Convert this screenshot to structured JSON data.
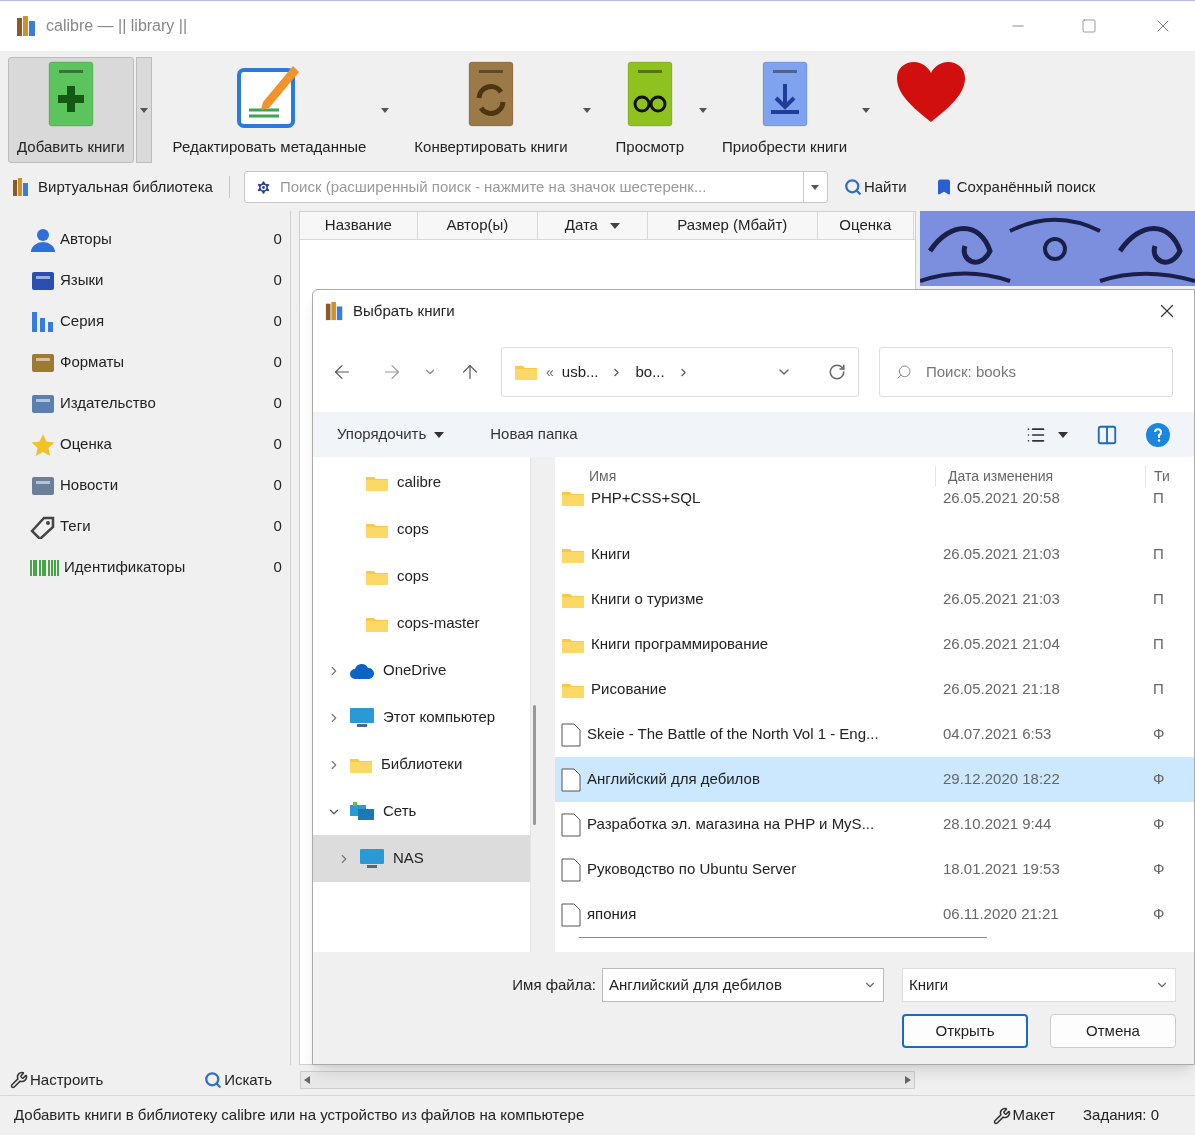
{
  "window": {
    "title": "calibre — || library ||"
  },
  "toolbar": [
    {
      "kind": "add",
      "label": "Добавить книги",
      "selected": true
    },
    {
      "kind": "edit",
      "label": "Редактировать метаданные",
      "selected": false
    },
    {
      "kind": "convert",
      "label": "Конвертировать книги",
      "selected": false
    },
    {
      "kind": "view",
      "label": "Просмотр",
      "selected": false
    },
    {
      "kind": "get",
      "label": "Приобрести книги",
      "selected": false
    },
    {
      "kind": "donate",
      "selected": false
    }
  ],
  "searchbar": {
    "virtual_library": "Виртуальная библиотека",
    "placeholder": "Поиск (расширенный поиск - нажмите на значок шестеренк...",
    "find": "Найти",
    "saved_search": "Сохранённый поиск"
  },
  "tag_browser": [
    {
      "kind": "authors",
      "label": "Авторы",
      "count": "0"
    },
    {
      "kind": "languages",
      "label": "Языки",
      "count": "0"
    },
    {
      "kind": "series",
      "label": "Серия",
      "count": "0"
    },
    {
      "kind": "formats",
      "label": "Форматы",
      "count": "0"
    },
    {
      "kind": "publisher",
      "label": "Издательство",
      "count": "0"
    },
    {
      "kind": "rating",
      "label": "Оценка",
      "count": "0"
    },
    {
      "kind": "news",
      "label": "Новости",
      "count": "0"
    },
    {
      "kind": "tags",
      "label": "Теги",
      "count": "0"
    },
    {
      "kind": "identifiers",
      "label": "Идентификаторы",
      "count": "0"
    }
  ],
  "table": {
    "columns": [
      {
        "label": "Название",
        "sorted": false
      },
      {
        "label": "Автор(ы)",
        "sorted": false
      },
      {
        "label": "Дата",
        "sorted": true
      },
      {
        "label": "Размер (Мбайт)",
        "sorted": false
      },
      {
        "label": "Оценка",
        "sorted": false
      }
    ]
  },
  "bottom": {
    "configure": "Настроить",
    "find": "Искать"
  },
  "status_bar": {
    "text": "Добавить книги в библиотеку calibre или на устройство из файлов на компьютере",
    "layout": "Макет",
    "jobs": "Задания: 0"
  },
  "dialog": {
    "title": "Выбрать книги",
    "overflow": "«",
    "breadcrumbs": [
      "usb...",
      "bo..."
    ],
    "search_placeholder": "Поиск: books",
    "organize": "Упорядочить",
    "new_folder": "Новая папка",
    "nav": [
      {
        "kind": "folder",
        "label": "calibre",
        "selected": false
      },
      {
        "kind": "folder",
        "label": "cops",
        "selected": false
      },
      {
        "kind": "folder",
        "label": "cops",
        "selected": false
      },
      {
        "kind": "folder",
        "label": "cops-master",
        "selected": false
      },
      {
        "kind": "cloud",
        "label": "OneDrive",
        "expanded": false,
        "selected": false
      },
      {
        "kind": "computer",
        "label": "Этот компьютер",
        "expanded": false,
        "selected": false
      },
      {
        "kind": "libraries",
        "label": "Библиотеки",
        "expanded": false,
        "selected": false
      },
      {
        "kind": "network",
        "label": "Сеть",
        "expanded": true,
        "selected": false,
        "children": [
          {
            "kind": "computer",
            "label": "NAS",
            "expanded": false,
            "selected": true
          }
        ]
      }
    ],
    "columns": [
      "Имя",
      "Дата изменения",
      "Ти"
    ],
    "files": [
      {
        "kind": "folder",
        "name": "PHP+CSS+SQL",
        "date": "26.05.2021 20:58",
        "column_3": "П",
        "selected": false
      },
      {
        "kind": "folder",
        "name": "Книги",
        "date": "26.05.2021 21:03",
        "column_3": "П",
        "selected": false
      },
      {
        "kind": "folder",
        "name": "Книги о туризме",
        "date": "26.05.2021 21:03",
        "column_3": "П",
        "selected": false
      },
      {
        "kind": "folder",
        "name": "Книги программирование",
        "date": "26.05.2021 21:04",
        "column_3": "П",
        "selected": false
      },
      {
        "kind": "folder",
        "name": "Рисование",
        "date": "26.05.2021 21:18",
        "column_3": "П",
        "selected": false
      },
      {
        "kind": "file",
        "name": "Skeie - The Battle of the North Vol 1 - Eng...",
        "date": "04.07.2021 6:53",
        "column_3": "Ф",
        "selected": false
      },
      {
        "kind": "file",
        "name": "Английский для дебилов",
        "date": "29.12.2020 18:22",
        "column_3": "Ф",
        "selected": true
      },
      {
        "kind": "file",
        "name": "Разработка эл. магазина на PHP и MyS...",
        "date": "28.10.2021 9:44",
        "column_3": "Ф",
        "selected": false
      },
      {
        "kind": "file",
        "name": "Руководство по Ubuntu Server",
        "date": "18.01.2021 19:53",
        "column_3": "Ф",
        "selected": false
      },
      {
        "kind": "file",
        "name": "япония",
        "date": "06.11.2020 21:21",
        "column_3": "Ф",
        "selected": false
      }
    ],
    "filename_label": "Имя файла:",
    "filename": "Английский для дебилов",
    "filter": "Книги",
    "open": "Открыть",
    "cancel": "Отмена"
  }
}
